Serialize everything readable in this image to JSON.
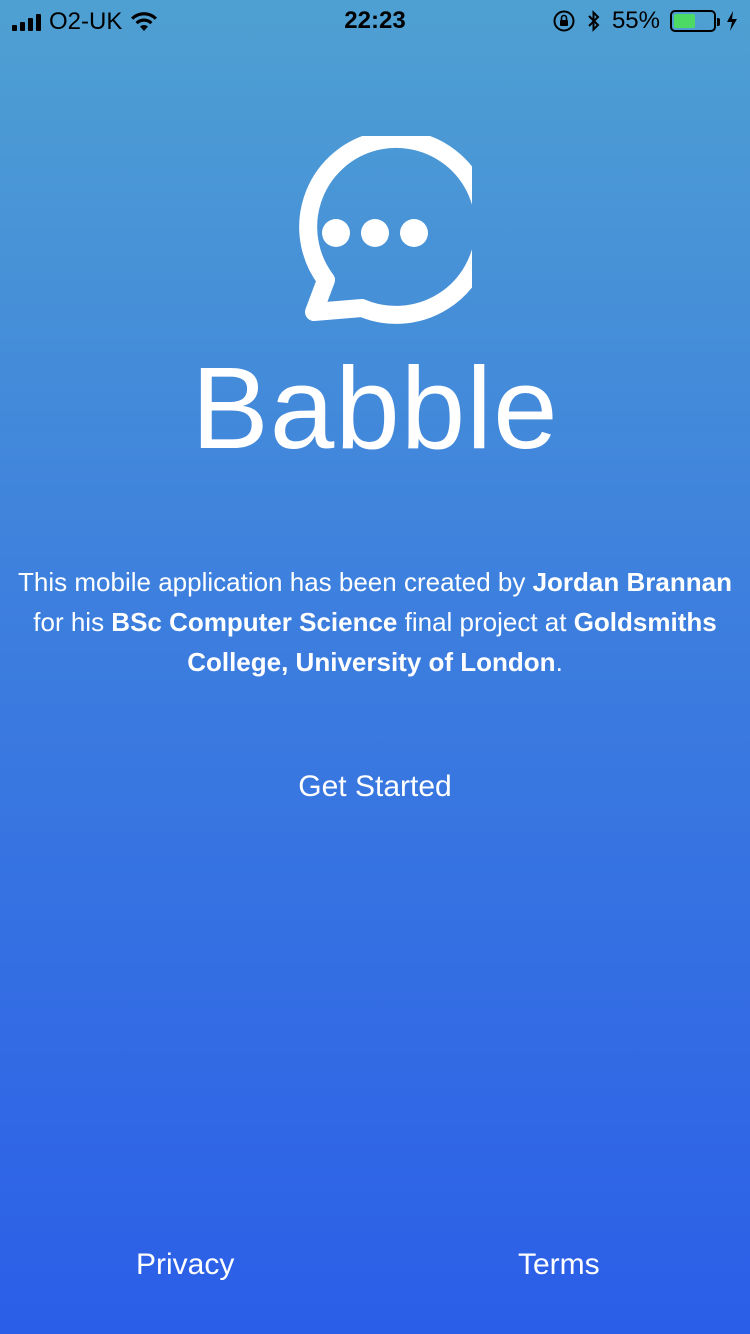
{
  "status_bar": {
    "carrier": "O2-UK",
    "time": "22:23",
    "battery_percent": "55%",
    "battery_level": 0.55,
    "icons": [
      "signal-icon",
      "wifi-icon",
      "rotation-lock-icon",
      "bluetooth-icon",
      "battery-icon",
      "charging-icon"
    ]
  },
  "app": {
    "name": "Babble",
    "logo_icon": "chat-bubble-icon"
  },
  "credits": {
    "t1": "This mobile application has been created by ",
    "author": "Jordan Brannan",
    "t2": " for his ",
    "degree": "BSc Computer Science",
    "t3": " final project at ",
    "institution": "Goldsmiths College, University of London",
    "t4": "."
  },
  "actions": {
    "get_started": "Get Started"
  },
  "footer": {
    "privacy": "Privacy",
    "terms": "Terms"
  },
  "colors": {
    "gradient_top": "#4fa0d2",
    "gradient_bottom": "#2b5ee8",
    "battery_fill": "#4cd964"
  }
}
